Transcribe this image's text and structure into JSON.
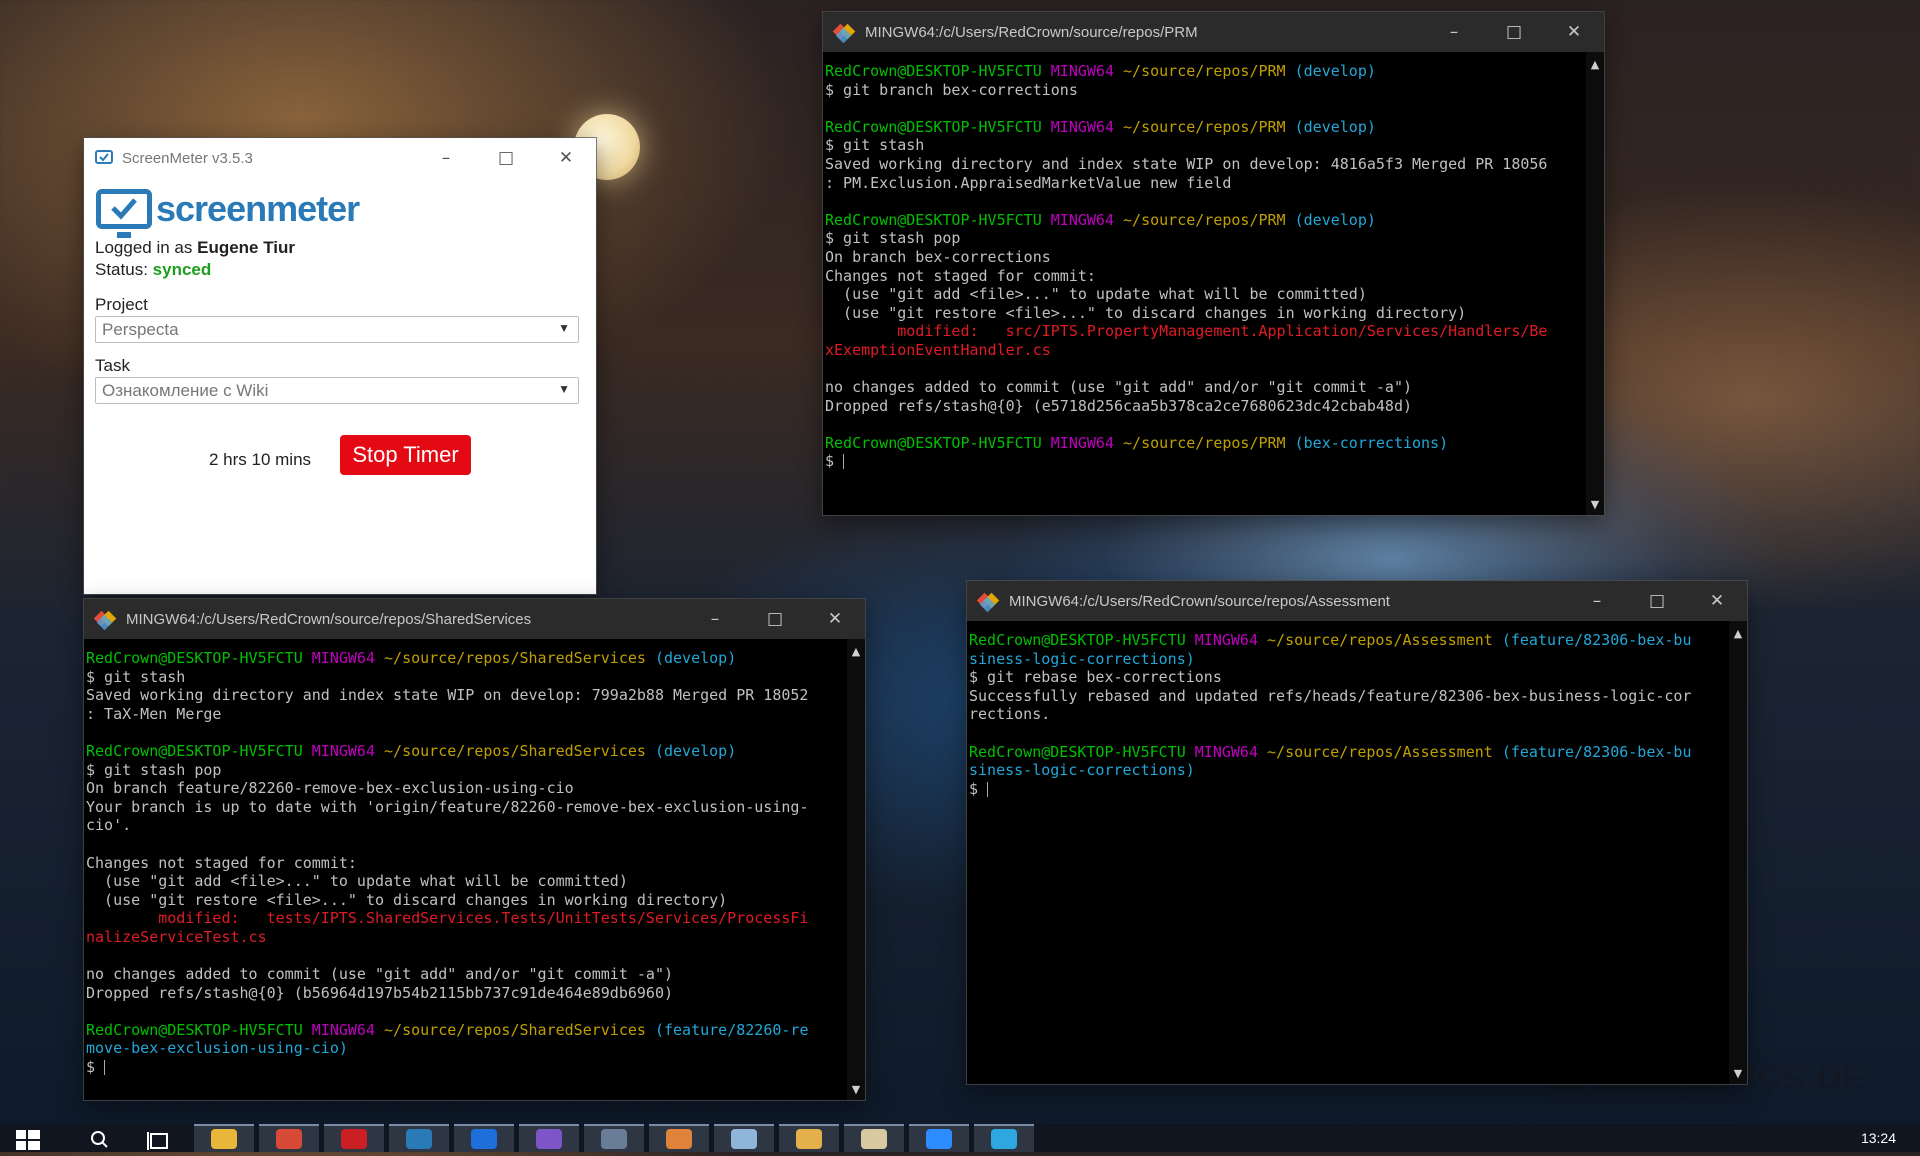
{
  "wallpaper": {
    "watermark": "GFXGRAPHICS.DE",
    "watermark_sub": "designs by tobias roetsch & jeff michelmann"
  },
  "screenmeter": {
    "title": "ScreenMeter v3.5.3",
    "brand": "screenmeter",
    "logged_prefix": "Logged in as",
    "user": "Eugene Tiur",
    "status_label": "Status:",
    "status_value": "synced",
    "project_label": "Project",
    "project_value": "Perspecta",
    "task_label": "Task",
    "task_value": "Ознакомление с Wiki",
    "elapsed": "2 hrs 10 mins",
    "stop_button": "Stop Timer",
    "colors": {
      "brand": "#2a7ab8",
      "status": "#1e9e1e",
      "stop": "#e50914"
    }
  },
  "terminals": {
    "prm": {
      "title": "MINGW64:/c/Users/RedCrown/source/repos/PRM",
      "lines": [
        [
          [
            "RedCrown@DESKTOP-HV5FCTU ",
            "g"
          ],
          [
            "MINGW64 ",
            "m"
          ],
          [
            "~/source/repos/PRM ",
            "y"
          ],
          [
            "(develop)",
            "c"
          ]
        ],
        [
          [
            "$ git branch bex-corrections",
            ""
          ]
        ],
        [],
        [
          [
            "RedCrown@DESKTOP-HV5FCTU ",
            "g"
          ],
          [
            "MINGW64 ",
            "m"
          ],
          [
            "~/source/repos/PRM ",
            "y"
          ],
          [
            "(develop)",
            "c"
          ]
        ],
        [
          [
            "$ git stash",
            ""
          ]
        ],
        [
          [
            "Saved working directory and index state WIP on develop: 4816a5f3 Merged PR 18056",
            ""
          ]
        ],
        [
          [
            ": PM.Exclusion.AppraisedMarketValue new field",
            ""
          ]
        ],
        [],
        [
          [
            "RedCrown@DESKTOP-HV5FCTU ",
            "g"
          ],
          [
            "MINGW64 ",
            "m"
          ],
          [
            "~/source/repos/PRM ",
            "y"
          ],
          [
            "(develop)",
            "c"
          ]
        ],
        [
          [
            "$ git stash pop",
            ""
          ]
        ],
        [
          [
            "On branch bex-corrections",
            ""
          ]
        ],
        [
          [
            "Changes not staged for commit:",
            ""
          ]
        ],
        [
          [
            "  (use \"git add <file>...\" to update what will be committed)",
            ""
          ]
        ],
        [
          [
            "  (use \"git restore <file>...\" to discard changes in working directory)",
            ""
          ]
        ],
        [
          [
            "        modified:   src/IPTS.PropertyManagement.Application/Services/Handlers/Be",
            "r"
          ]
        ],
        [
          [
            "xExemptionEventHandler.cs",
            "r"
          ]
        ],
        [],
        [
          [
            "no changes added to commit (use \"git add\" and/or \"git commit -a\")",
            ""
          ]
        ],
        [
          [
            "Dropped refs/stash@{0} (e5718d256caa5b378ca2ce7680623dc42cbab48d)",
            ""
          ]
        ],
        [],
        [
          [
            "RedCrown@DESKTOP-HV5FCTU ",
            "g"
          ],
          [
            "MINGW64 ",
            "m"
          ],
          [
            "~/source/repos/PRM ",
            "y"
          ],
          [
            "(bex-corrections)",
            "c"
          ]
        ],
        [
          [
            "$ ",
            ""
          ]
        ]
      ]
    },
    "shared": {
      "title": "MINGW64:/c/Users/RedCrown/source/repos/SharedServices",
      "lines": [
        [
          [
            "RedCrown@DESKTOP-HV5FCTU ",
            "g"
          ],
          [
            "MINGW64 ",
            "m"
          ],
          [
            "~/source/repos/SharedServices ",
            "y"
          ],
          [
            "(develop)",
            "c"
          ]
        ],
        [
          [
            "$ git stash",
            ""
          ]
        ],
        [
          [
            "Saved working directory and index state WIP on develop: 799a2b88 Merged PR 18052",
            ""
          ]
        ],
        [
          [
            ": TaX-Men Merge",
            ""
          ]
        ],
        [],
        [
          [
            "RedCrown@DESKTOP-HV5FCTU ",
            "g"
          ],
          [
            "MINGW64 ",
            "m"
          ],
          [
            "~/source/repos/SharedServices ",
            "y"
          ],
          [
            "(develop)",
            "c"
          ]
        ],
        [
          [
            "$ git stash pop",
            ""
          ]
        ],
        [
          [
            "On branch feature/82260-remove-bex-exclusion-using-cio",
            ""
          ]
        ],
        [
          [
            "Your branch is up to date with 'origin/feature/82260-remove-bex-exclusion-using-",
            ""
          ]
        ],
        [
          [
            "cio'.",
            ""
          ]
        ],
        [],
        [
          [
            "Changes not staged for commit:",
            ""
          ]
        ],
        [
          [
            "  (use \"git add <file>...\" to update what will be committed)",
            ""
          ]
        ],
        [
          [
            "  (use \"git restore <file>...\" to discard changes in working directory)",
            ""
          ]
        ],
        [
          [
            "        modified:   tests/IPTS.SharedServices.Tests/UnitTests/Services/ProcessFi",
            "r"
          ]
        ],
        [
          [
            "nalizeServiceTest.cs",
            "r"
          ]
        ],
        [],
        [
          [
            "no changes added to commit (use \"git add\" and/or \"git commit -a\")",
            ""
          ]
        ],
        [
          [
            "Dropped refs/stash@{0} (b56964d197b54b2115bb737c91de464e89db6960)",
            ""
          ]
        ],
        [],
        [
          [
            "RedCrown@DESKTOP-HV5FCTU ",
            "g"
          ],
          [
            "MINGW64 ",
            "m"
          ],
          [
            "~/source/repos/SharedServices ",
            "y"
          ],
          [
            "(feature/82260-re",
            "c"
          ]
        ],
        [
          [
            "move-bex-exclusion-using-cio)",
            "c"
          ]
        ],
        [
          [
            "$ ",
            ""
          ]
        ]
      ]
    },
    "assessment": {
      "title": "MINGW64:/c/Users/RedCrown/source/repos/Assessment",
      "lines": [
        [
          [
            "RedCrown@DESKTOP-HV5FCTU ",
            "g"
          ],
          [
            "MINGW64 ",
            "m"
          ],
          [
            "~/source/repos/Assessment ",
            "y"
          ],
          [
            "(feature/82306-bex-bu",
            "c"
          ]
        ],
        [
          [
            "siness-logic-corrections)",
            "c"
          ]
        ],
        [
          [
            "$ git rebase bex-corrections",
            ""
          ]
        ],
        [
          [
            "Successfully rebased and updated refs/heads/feature/82306-bex-business-logic-cor",
            ""
          ]
        ],
        [
          [
            "rections.",
            ""
          ]
        ],
        [],
        [
          [
            "RedCrown@DESKTOP-HV5FCTU ",
            "g"
          ],
          [
            "MINGW64 ",
            "m"
          ],
          [
            "~/source/repos/Assessment ",
            "y"
          ],
          [
            "(feature/82306-bex-bu",
            "c"
          ]
        ],
        [
          [
            "siness-logic-corrections)",
            "c"
          ]
        ],
        [
          [
            "$ ",
            ""
          ]
        ]
      ]
    }
  },
  "taskbar": {
    "clock": "13:24",
    "apps": [
      {
        "name": "file-explorer-icon",
        "color": "#e8b73a"
      },
      {
        "name": "chrome-icon",
        "color": "#d84a38"
      },
      {
        "name": "opera-icon",
        "color": "#cc1f24"
      },
      {
        "name": "screenmeter-icon",
        "color": "#2a7ab8"
      },
      {
        "name": "app-icon",
        "color": "#1e6fd9"
      },
      {
        "name": "visual-studio-icon",
        "color": "#7d55c7"
      },
      {
        "name": "window-icon",
        "color": "#6a7d96"
      },
      {
        "name": "compass-icon",
        "color": "#e0833a"
      },
      {
        "name": "notepad-icon",
        "color": "#8fb6d9"
      },
      {
        "name": "folder-icon",
        "color": "#e4b04a"
      },
      {
        "name": "editor-icon",
        "color": "#d9c9a0"
      },
      {
        "name": "zoom-icon",
        "color": "#2d8cff"
      },
      {
        "name": "telegram-icon",
        "color": "#2ea6e0"
      }
    ]
  }
}
